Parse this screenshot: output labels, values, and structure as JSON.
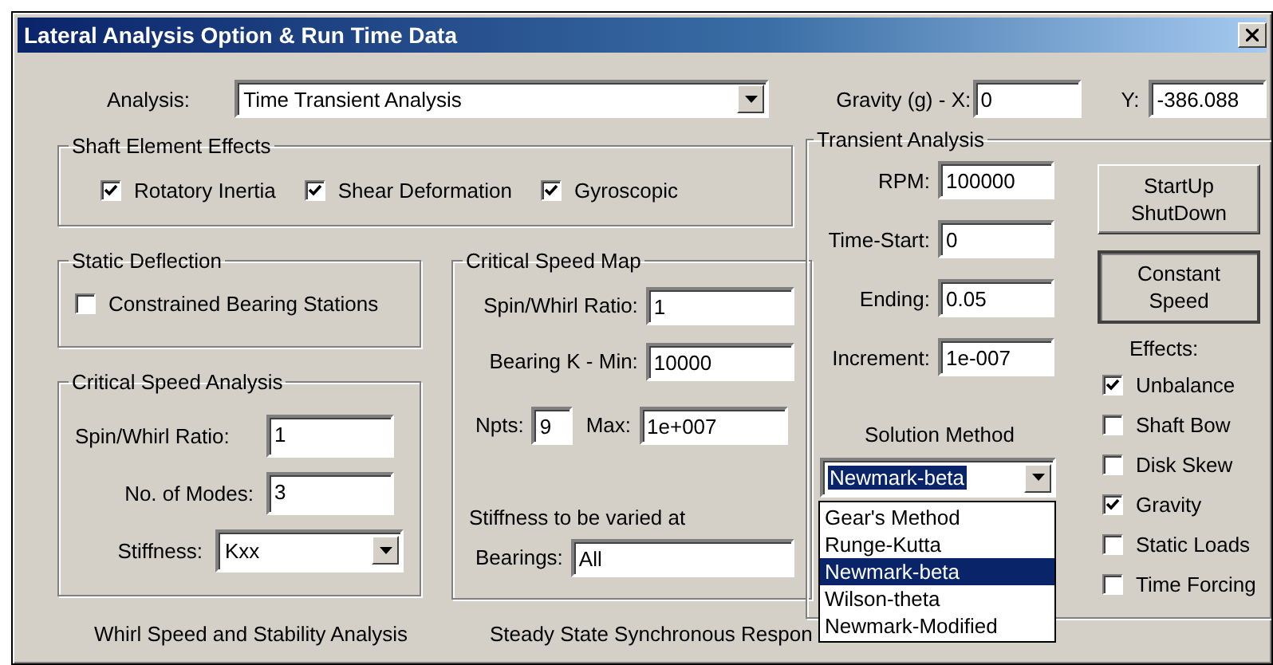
{
  "window": {
    "title": "Lateral Analysis Option & Run Time Data"
  },
  "analysis": {
    "label": "Analysis:",
    "value": "Time Transient Analysis"
  },
  "gravity": {
    "x_label": "Gravity (g) - X:",
    "x_value": "0",
    "y_label": "Y:",
    "y_value": "-386.088"
  },
  "shaft_element_effects": {
    "title": "Shaft Element Effects",
    "items": [
      {
        "label": "Rotatory Inertia",
        "checked": true
      },
      {
        "label": "Shear Deformation",
        "checked": true
      },
      {
        "label": "Gyroscopic",
        "checked": true
      }
    ]
  },
  "static_deflection": {
    "title": "Static Deflection",
    "items": [
      {
        "label": "Constrained Bearing Stations",
        "checked": false
      }
    ]
  },
  "critical_speed_analysis": {
    "title": "Critical Speed Analysis",
    "fields": [
      {
        "label": "Spin/Whirl Ratio:",
        "value": "1"
      },
      {
        "label": "No. of Modes:",
        "value": "3"
      }
    ],
    "stiffness": {
      "label": "Stiffness:",
      "value": "Kxx"
    }
  },
  "critical_speed_map": {
    "title": "Critical Speed Map",
    "spin_whirl": {
      "label": "Spin/Whirl Ratio:",
      "value": "1"
    },
    "bearing_k_min": {
      "label": "Bearing K - Min:",
      "value": "10000"
    },
    "npts": {
      "label": "Npts:",
      "value": "9"
    },
    "max": {
      "label": "Max:",
      "value": "1e+007"
    },
    "note": "Stiffness to be varied at",
    "bearings": {
      "label": "Bearings:",
      "value": "All"
    }
  },
  "transient_analysis": {
    "title": "Transient Analysis",
    "fields": [
      {
        "label": "RPM:",
        "value": "100000"
      },
      {
        "label": "Time-Start:",
        "value": "0"
      },
      {
        "label": "Ending:",
        "value": "0.05"
      },
      {
        "label": "Increment:",
        "value": "1e-007"
      }
    ],
    "buttons": [
      {
        "label": "StartUp ShutDown",
        "selected": false
      },
      {
        "label": "Constant Speed",
        "selected": true
      }
    ],
    "effects_label": "Effects:",
    "effects": [
      {
        "label": "Unbalance",
        "checked": true
      },
      {
        "label": "Shaft Bow",
        "checked": false
      },
      {
        "label": "Disk Skew",
        "checked": false
      },
      {
        "label": "Gravity",
        "checked": true
      },
      {
        "label": "Static Loads",
        "checked": false
      },
      {
        "label": "Time Forcing",
        "checked": false
      }
    ],
    "solution_method": {
      "label": "Solution Method",
      "value": "Newmark-beta",
      "focused": true,
      "options": [
        {
          "label": "Gear's Method",
          "selected": false
        },
        {
          "label": "Runge-Kutta",
          "selected": false
        },
        {
          "label": "Newmark-beta",
          "selected": true
        },
        {
          "label": "Wilson-theta",
          "selected": false
        },
        {
          "label": "Newmark-Modified",
          "selected": false
        }
      ]
    }
  },
  "bottom_groups": [
    "Whirl Speed and Stability Analysis",
    "Steady State Synchronous Respon"
  ]
}
